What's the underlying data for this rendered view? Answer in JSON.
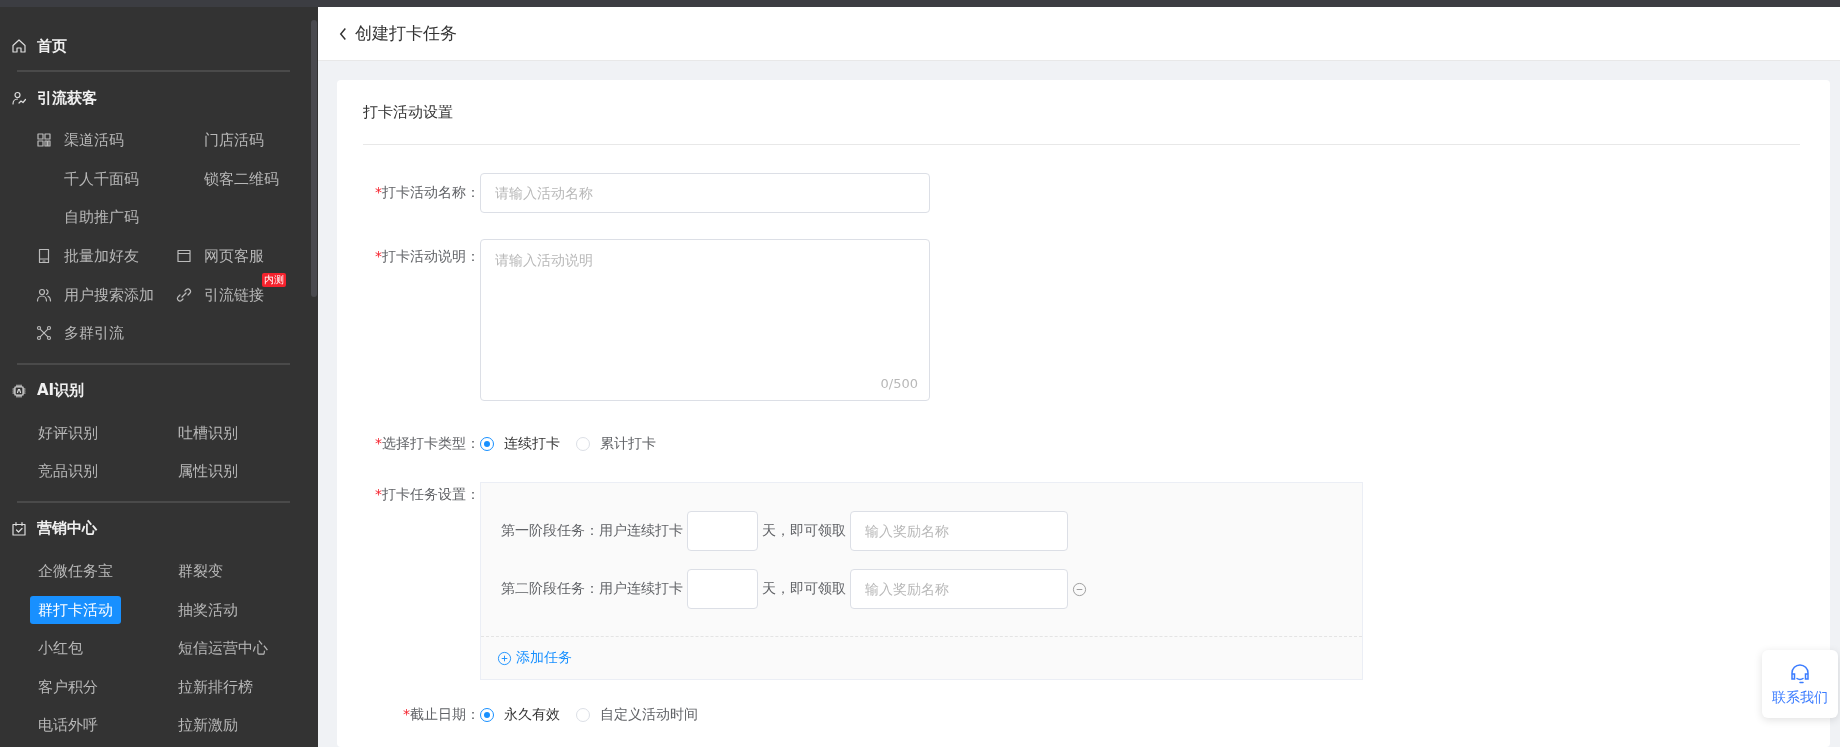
{
  "sidebar": {
    "sections": [
      {
        "title": "首页"
      },
      {
        "title": "引流获客",
        "rows": [
          [
            {
              "label": "渠道活码",
              "selected": false
            },
            {
              "label": "门店活码",
              "selected": false
            }
          ],
          [
            {
              "label": "千人千面码",
              "selected": false
            },
            {
              "label": "锁客二维码",
              "selected": false
            }
          ],
          [
            {
              "label": "自助推广码",
              "selected": false
            }
          ],
          [
            {
              "label": "批量加好友",
              "selected": false
            },
            {
              "label": "网页客服",
              "selected": false
            }
          ],
          [
            {
              "label": "用户搜索添加",
              "selected": false
            },
            {
              "label": "引流链接",
              "selected": false,
              "badge": "内测"
            }
          ],
          [
            {
              "label": "多群引流",
              "selected": false
            }
          ]
        ]
      },
      {
        "title": "AI识别",
        "rows": [
          [
            {
              "label": "好评识别",
              "selected": false
            },
            {
              "label": "吐槽识别",
              "selected": false
            }
          ],
          [
            {
              "label": "竞品识别",
              "selected": false
            },
            {
              "label": "属性识别",
              "selected": false
            }
          ]
        ]
      },
      {
        "title": "营销中心",
        "rows": [
          [
            {
              "label": "企微任务宝",
              "selected": false
            },
            {
              "label": "群裂变",
              "selected": false
            }
          ],
          [
            {
              "label": "群打卡活动",
              "selected": true
            },
            {
              "label": "抽奖活动",
              "selected": false
            }
          ],
          [
            {
              "label": "小红包",
              "selected": false
            },
            {
              "label": "短信运营中心",
              "selected": false
            }
          ],
          [
            {
              "label": "客户积分",
              "selected": false
            },
            {
              "label": "拉新排行榜",
              "selected": false
            }
          ],
          [
            {
              "label": "电话外呼",
              "selected": false
            },
            {
              "label": "拉新激励",
              "selected": false
            }
          ]
        ]
      }
    ]
  },
  "header": {
    "title": "创建打卡任务"
  },
  "form": {
    "section_title": "打卡活动设置",
    "name_field": {
      "required_mark": "*",
      "label": "打卡活动名称：",
      "placeholder": "请输入活动名称"
    },
    "description_field": {
      "required_mark": "*",
      "label": "打卡活动说明：",
      "placeholder": "请输入活动说明",
      "counter": "0/500"
    },
    "checkin_type": {
      "required_mark": "*",
      "label": "选择打卡类型：",
      "options": [
        {
          "label": "连续打卡",
          "selected": true
        },
        {
          "label": "累计打卡",
          "selected": false
        }
      ]
    },
    "task_settings": {
      "required_mark": "*",
      "label": "打卡任务设置：",
      "stages": [
        {
          "prefix": "第一阶段任务：用户连续打卡",
          "suffix": "天，即可领取",
          "reward_placeholder": "输入奖励名称"
        },
        {
          "prefix": "第二阶段任务：用户连续打卡",
          "suffix": "天，即可领取",
          "reward_placeholder": "输入奖励名称",
          "removable": true
        }
      ],
      "add_button": "添加任务"
    },
    "deadline": {
      "required_mark": "*",
      "label": "截止日期：",
      "options": [
        {
          "label": "永久有效",
          "selected": true
        },
        {
          "label": "自定义活动时间",
          "selected": false
        }
      ]
    }
  },
  "contact": {
    "label": "联系我们"
  }
}
